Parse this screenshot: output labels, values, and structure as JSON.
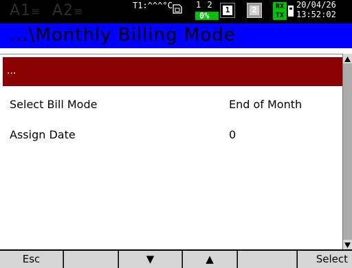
{
  "status_bar": {
    "alarm1": "A1",
    "alarm2": "A2",
    "temperature": "T1:^^^°C",
    "channel_label": "1 2",
    "percent": "0%",
    "box1_label": "1",
    "box2_label": "2",
    "rx": "RX",
    "tx": "TX",
    "date": "20/04/26",
    "time": "13:52:02",
    "colors": {
      "level_bar": "#00c000",
      "rxtx": "#00c000"
    }
  },
  "title": "...\\Monthly Billing Mode",
  "menu": {
    "path_row": "...",
    "rows": [
      {
        "label": "Select Bill Mode",
        "value": "End of Month"
      },
      {
        "label": "Assign Date",
        "value": "0"
      }
    ]
  },
  "softkeys": {
    "esc": "Esc",
    "blank1": "",
    "down": "▼",
    "up": "▲",
    "blank2": "",
    "select": "Select"
  },
  "colors": {
    "title_bar": "#0000ff",
    "selected_row": "#8b0000",
    "softkey_bg": "#d6d6d6"
  }
}
